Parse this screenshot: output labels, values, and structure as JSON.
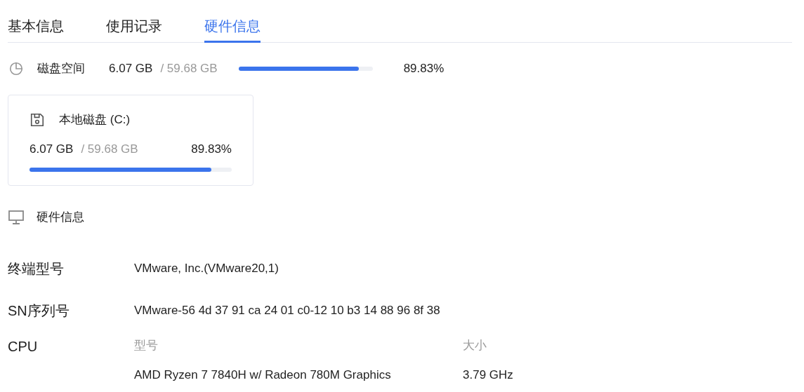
{
  "tabs": [
    {
      "label": "基本信息",
      "selected": false
    },
    {
      "label": "使用记录",
      "selected": false
    },
    {
      "label": "硬件信息",
      "selected": true
    }
  ],
  "disk_space": {
    "label": "磁盘空间",
    "used": "6.07 GB",
    "total": "/ 59.68 GB",
    "level": 0.8983,
    "percent": "89.83%"
  },
  "disks": [
    {
      "name": "本地磁盘 (C:)",
      "used": "6.07 GB",
      "total": "/ 59.68 GB",
      "percent": "89.83%",
      "level": 0.8983
    }
  ],
  "hardware": {
    "title": "硬件信息",
    "rows": [
      {
        "kind": "text",
        "label": "终端型号",
        "value": "VMware, Inc.(VMware20,1)"
      },
      {
        "kind": "text",
        "label": "SN序列号",
        "value": "VMware-56 4d 37 91 ca 24 01 c0-12 10 b3 14 88 96 8f 38"
      },
      {
        "kind": "table",
        "label": "CPU",
        "columns": [
          "型号",
          "大小"
        ],
        "rows": [
          [
            "AMD Ryzen 7 7840H w/ Radeon 780M Graphics",
            "3.79 GHz"
          ]
        ]
      }
    ]
  }
}
